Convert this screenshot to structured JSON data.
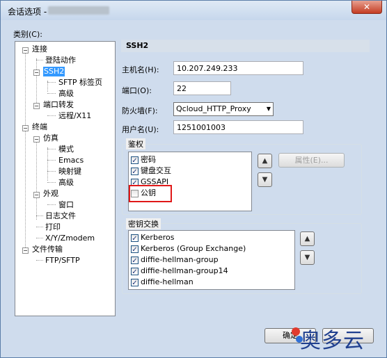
{
  "window": {
    "title": "会话选项 -",
    "close": "✕"
  },
  "category_label": "类别(C):",
  "tree": [
    {
      "label": "连接",
      "expander": "−"
    },
    {
      "label": "登陆动作"
    },
    {
      "label": "SSH2"
    },
    {
      "label": "SFTP 标签页"
    },
    {
      "label": "高级"
    },
    {
      "label": "端口转发",
      "expander": "−"
    },
    {
      "label": "远程/X11"
    },
    {
      "label": "终端",
      "expander": "−"
    },
    {
      "label": "仿真",
      "expander": "−"
    },
    {
      "label": "模式"
    },
    {
      "label": "Emacs"
    },
    {
      "label": "映射键"
    },
    {
      "label": "高级"
    },
    {
      "label": "外观",
      "expander": "−"
    },
    {
      "label": "窗口"
    },
    {
      "label": "日志文件"
    },
    {
      "label": "打印"
    },
    {
      "label": "X/Y/Zmodem"
    },
    {
      "label": "文件传输",
      "expander": "−"
    },
    {
      "label": "FTP/SFTP"
    }
  ],
  "section_title": "SSH2",
  "fields": {
    "hostname": {
      "label": "主机名(H):",
      "value": "10.207.249.233"
    },
    "port": {
      "label": "端口(O):",
      "value": "22"
    },
    "firewall": {
      "label": "防火墙(F):",
      "value": "Qcloud_HTTP_Proxy"
    },
    "username": {
      "label": "用户名(U):",
      "value": "1251001003"
    }
  },
  "auth": {
    "title": "鉴权",
    "items": [
      {
        "label": "密码",
        "checked": true
      },
      {
        "label": "键盘交互",
        "checked": true
      },
      {
        "label": "GSSAPI",
        "checked": true
      },
      {
        "label": "公钥",
        "checked": false
      }
    ],
    "properties_button": "属性(E)..."
  },
  "kex": {
    "title": "密钥交换",
    "items": [
      {
        "label": "Kerberos",
        "checked": true
      },
      {
        "label": "Kerberos (Group Exchange)",
        "checked": true
      },
      {
        "label": "diffie-hellman-group",
        "checked": true
      },
      {
        "label": "diffie-hellman-group14",
        "checked": true
      },
      {
        "label": "diffie-hellman",
        "checked": true
      }
    ]
  },
  "buttons": {
    "ok": "确定"
  },
  "watermark": "奥多云",
  "glyphs": {
    "check": "✓",
    "up": "▲",
    "down": "▼",
    "dropdown": "▼"
  }
}
